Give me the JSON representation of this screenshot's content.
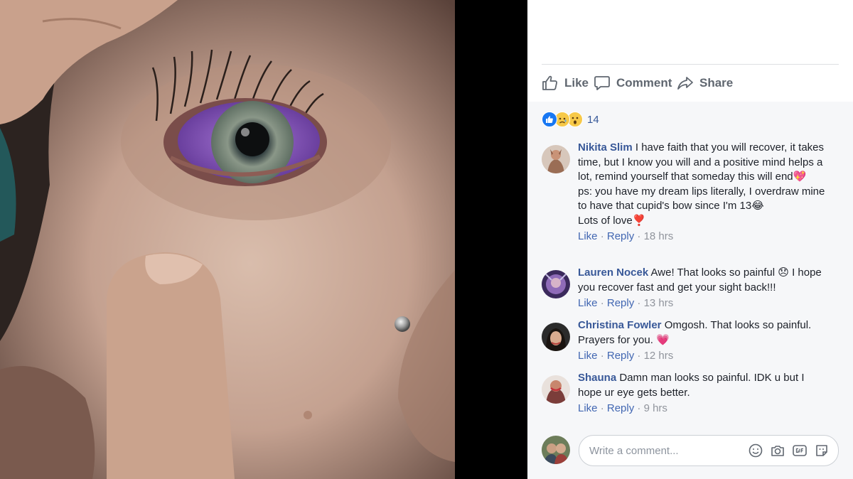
{
  "actions": {
    "like": "Like",
    "comment": "Comment",
    "share": "Share"
  },
  "reactions": {
    "types": [
      "like-icon",
      "sad-icon",
      "wow-icon"
    ],
    "count": "14"
  },
  "comments": [
    {
      "name": "Nikita Slim",
      "text": "I have faith that you will recover, it takes time, but I know you will and a positive mind helps a lot, remind yourself that someday this will end💖",
      "text2": "ps: you have my dream lips literally, I overdraw mine to have that cupid's bow since I'm 13😂",
      "text3": "Lots of love❣️",
      "like": "Like",
      "reply": "Reply",
      "time": "18 hrs"
    },
    {
      "name": "Lauren Nocek",
      "text": "Awe! That looks so painful 😞 I hope you recover fast and get your sight back!!!",
      "like": "Like",
      "reply": "Reply",
      "time": "13 hrs"
    },
    {
      "name": "Christina Fowler",
      "text": "Omgosh. That looks so painful. Prayers for you. 💗",
      "like": "Like",
      "reply": "Reply",
      "time": "12 hrs"
    },
    {
      "name": "Shauna",
      "text": "Damn man looks so painful. IDK u but I hope ur eye gets better.",
      "like": "Like",
      "reply": "Reply",
      "time": "9 hrs"
    }
  ],
  "composer": {
    "placeholder": "Write a comment...",
    "icons": [
      "emoji-icon",
      "camera-icon",
      "gif-icon",
      "sticker-icon"
    ]
  },
  "colors": {
    "link": "#385898",
    "meta": "#90949c",
    "accent": "#4267b2",
    "panel_bg": "#f6f7f9"
  }
}
